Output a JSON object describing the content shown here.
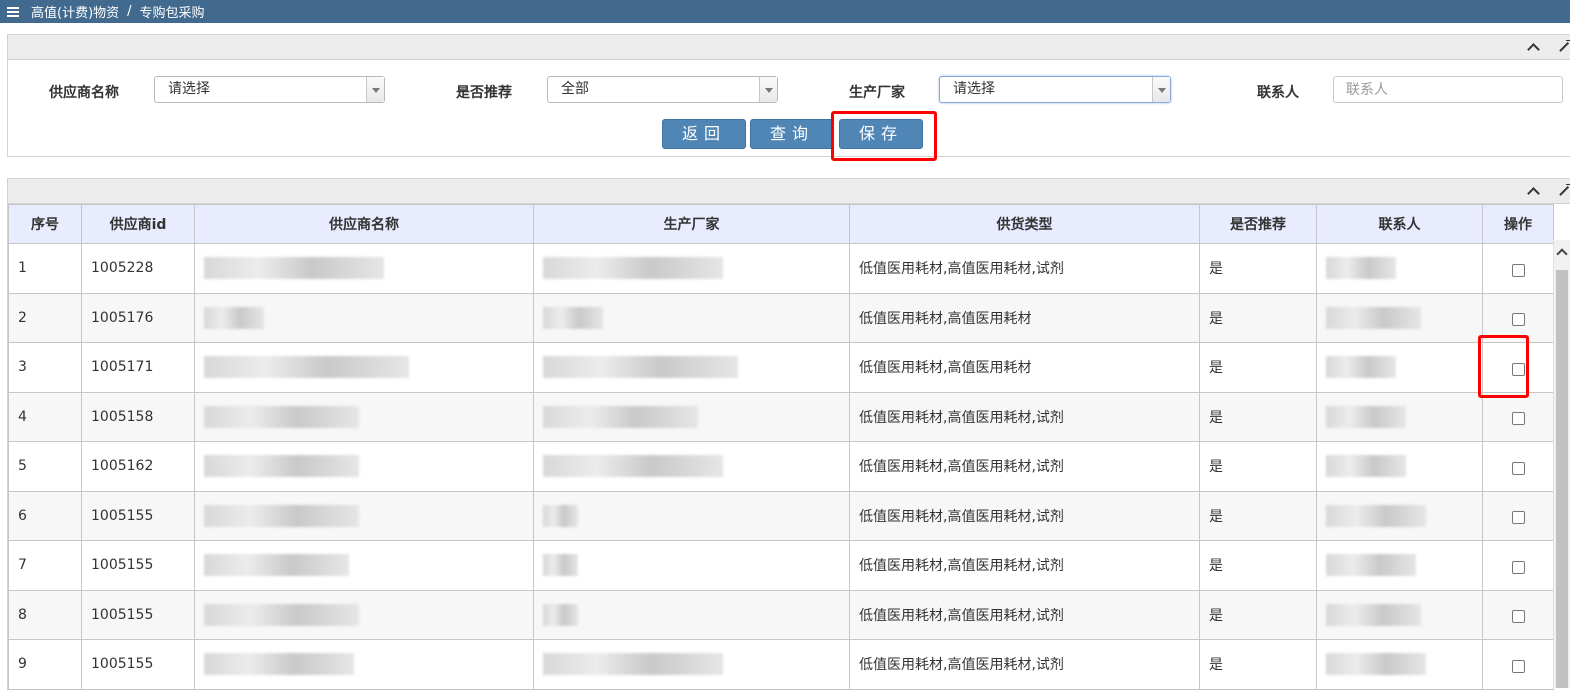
{
  "breadcrumb": {
    "parent": "高值(计费)物资",
    "separator": "/",
    "current": "专购包采购"
  },
  "search_form": {
    "supplier_name_label": "供应商名称",
    "supplier_name_value": "请选择",
    "recommended_label": "是否推荐",
    "recommended_value": "全部",
    "manufacturer_label": "生产厂家",
    "manufacturer_value": "请选择",
    "contact_label": "联系人",
    "contact_placeholder": "联系人"
  },
  "buttons": {
    "back": "返回",
    "query": "查询",
    "save": "保存"
  },
  "table": {
    "columns": [
      "序号",
      "供应商id",
      "供应商名称",
      "生产厂家",
      "供货类型",
      "是否推荐",
      "联系人",
      "操作"
    ],
    "rows": [
      {
        "no": "1",
        "id": "1005228",
        "type": "低值医用耗材,高值医用耗材,试剂",
        "recommended": "是"
      },
      {
        "no": "2",
        "id": "1005176",
        "type": "低值医用耗材,高值医用耗材",
        "recommended": "是"
      },
      {
        "no": "3",
        "id": "1005171",
        "type": "低值医用耗材,高值医用耗材",
        "recommended": "是"
      },
      {
        "no": "4",
        "id": "1005158",
        "type": "低值医用耗材,高值医用耗材,试剂",
        "recommended": "是"
      },
      {
        "no": "5",
        "id": "1005162",
        "type": "低值医用耗材,高值医用耗材,试剂",
        "recommended": "是"
      },
      {
        "no": "6",
        "id": "1005155",
        "type": "低值医用耗材,高值医用耗材,试剂",
        "recommended": "是"
      },
      {
        "no": "7",
        "id": "1005155",
        "type": "低值医用耗材,高值医用耗材,试剂",
        "recommended": "是"
      },
      {
        "no": "8",
        "id": "1005155",
        "type": "低值医用耗材,高值医用耗材,试剂",
        "recommended": "是"
      },
      {
        "no": "9",
        "id": "1005155",
        "type": "低值医用耗材,高值医用耗材,试剂",
        "recommended": "是"
      }
    ]
  },
  "colors": {
    "topbar": "#426a8e",
    "button": "#4f86b6",
    "highlight": "#ff0000",
    "table_header": "#e9ebff"
  }
}
